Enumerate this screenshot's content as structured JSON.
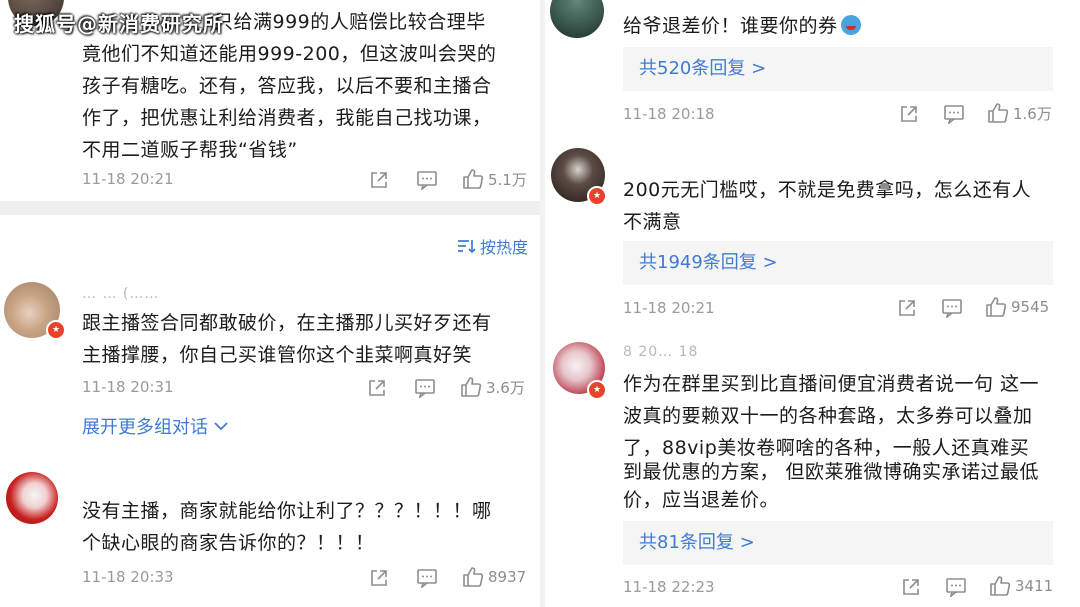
{
  "watermark": "搜狐号@新消费研究所",
  "left": {
    "c1": {
      "lines": [
        "只给满999的人赔偿比较合理毕",
        "竟他们不知道还能用999-200，但这波叫会哭的",
        "孩子有糖吃。还有，答应我，以后不要和主播合",
        "作了，把优惠让利给消费者，我能自己找功课，",
        "不用二道贩子帮我“省钱”"
      ],
      "time": "11-18 20:21",
      "likes": "5.1万"
    },
    "sort_label": "按热度",
    "c2": {
      "nick": "… … (……",
      "lines": [
        "跟主播签合同都敢破价，在主播那儿买好歹还有",
        "主播撑腰，你自己买谁管你这个韭菜啊真好笑"
      ],
      "time": "11-18 20:31",
      "likes": "3.6万"
    },
    "expand_label": "展开更多组对话",
    "c3": {
      "lines": [
        "没有主播，商家就能给你让利了？？？！！！哪",
        "个缺心眼的商家告诉你的？！！！"
      ],
      "time": "11-18 20:33",
      "likes": "8937"
    }
  },
  "right": {
    "c1": {
      "line": "给爷退差价！谁要你的券",
      "replies": "共520条回复 >",
      "time": "11-18 20:18",
      "likes": "1.6万"
    },
    "c2": {
      "lines": [
        "200元无门槛哎，不就是免费拿吗，怎么还有人",
        "不满意"
      ],
      "replies": "共1949条回复 >",
      "time": "11-18 20:21",
      "likes": "9545"
    },
    "c3": {
      "nick": "8 20… 18",
      "lines": [
        "作为在群里买到比直播间便宜消费者说一句 这一",
        "波真的要赖双十一的各种套路，太多券可以叠加",
        "了，88vip美妆卷啊啥的各种，一般人还真难买",
        "到最优惠的方案， 但欧莱雅微博确实承诺过最低",
        "价，应当退差价。"
      ],
      "replies": "共81条回复 >",
      "time": "11-18 22:23",
      "likes": "3411"
    }
  },
  "colors": {
    "link": "#3f7bd6",
    "meta": "#9a9a9a",
    "badge": "#e8412c"
  },
  "icons": [
    "share-icon",
    "comment-icon",
    "like-icon",
    "sort-icon",
    "chevron-down-icon",
    "v-badge-icon"
  ]
}
